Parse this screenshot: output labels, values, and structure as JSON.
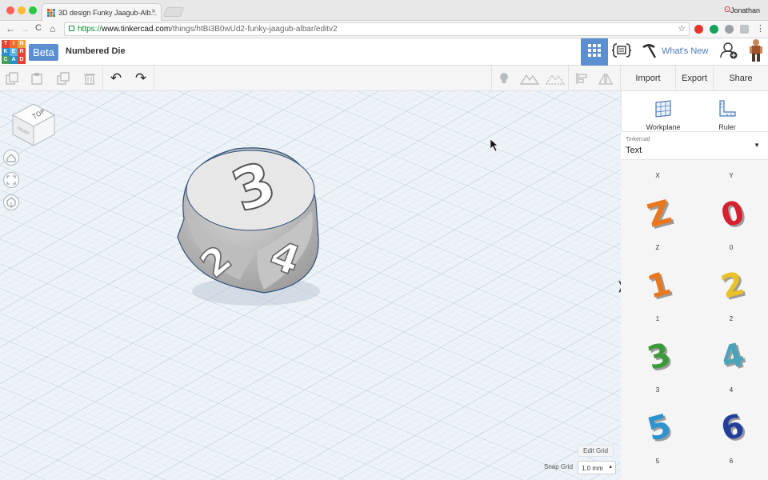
{
  "browser": {
    "tab_title": "3D design Funky Jaagub-Alb...",
    "tab_close": "×",
    "user_name": "Jonathan",
    "url_prefix": "https://",
    "url_host": "www.tinkercad.com",
    "url_path": "/things/htBi3B0wUd2-funky-jaagub-albar/editv2",
    "nav": {
      "back": "←",
      "forward": "→",
      "reload": "C",
      "home": "⌂"
    },
    "star": "☆"
  },
  "app": {
    "logo_letters": [
      "T",
      "I",
      "N",
      "K",
      "E",
      "R",
      "C",
      "A",
      "D"
    ],
    "logo_colors": [
      "#e8412f",
      "#ef6d2b",
      "#f4a13a",
      "#2a8ec9",
      "#5eb4e4",
      "#e8412f",
      "#44a05b",
      "#2a8ec9",
      "#e8412f"
    ],
    "beta": "Beta",
    "design_title": "Numbered Die",
    "whats_new": "What's New",
    "accent": "#5b8fd0"
  },
  "toolbar": {
    "import": "Import",
    "export": "Export",
    "share": "Share",
    "undo": "↶",
    "redo": "↷"
  },
  "viewport": {
    "viewcube_top": "TOP",
    "viewcube_front": "FRONT",
    "edit_grid": "Edit Grid",
    "snap_grid_label": "Snap Grid",
    "snap_grid_value": "1.0 mm",
    "snap_arrow": "▴",
    "panel_toggle": "❭",
    "die_faces": {
      "top": "3",
      "left": "2",
      "right": "4"
    }
  },
  "panel": {
    "workplane": "Workplane",
    "ruler": "Ruler",
    "library_caption": "Tinkercad",
    "library_value": "Text",
    "library_arrow": "▼",
    "header_letters": [
      "X",
      "Y"
    ],
    "shapes": [
      {
        "glyph": "Z",
        "label": "Z",
        "color": "#e8771e"
      },
      {
        "glyph": "0",
        "label": "0",
        "color": "#d71f2d"
      },
      {
        "glyph": "1",
        "label": "1",
        "color": "#e8771e"
      },
      {
        "glyph": "2",
        "label": "2",
        "color": "#e9c126"
      },
      {
        "glyph": "3",
        "label": "3",
        "color": "#3c9a3a"
      },
      {
        "glyph": "4",
        "label": "4",
        "color": "#4aa3b8"
      },
      {
        "glyph": "5",
        "label": "5",
        "color": "#2a93d0"
      },
      {
        "glyph": "6",
        "label": "6",
        "color": "#233f9a"
      }
    ]
  }
}
